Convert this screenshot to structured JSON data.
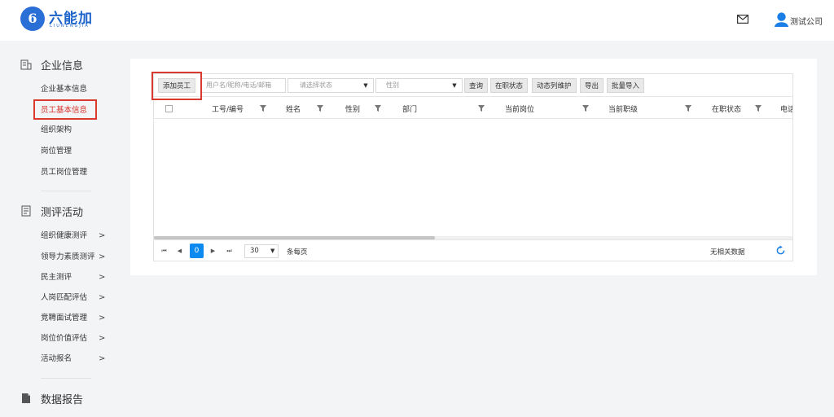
{
  "header": {
    "brand_cn": "六能加",
    "brand_en": "LIUNENGJIA",
    "logo_mark": "6",
    "company": "测试公司"
  },
  "sidebar": {
    "sections": [
      {
        "title": "企业信息",
        "icon": "building-icon",
        "items": [
          {
            "label": "企业基本信息",
            "arrow": ""
          },
          {
            "label": "员工基本信息",
            "arrow": "",
            "active": true
          },
          {
            "label": "组织架构",
            "arrow": ""
          },
          {
            "label": "岗位管理",
            "arrow": ""
          },
          {
            "label": "员工岗位管理",
            "arrow": ""
          }
        ]
      },
      {
        "title": "测评活动",
        "icon": "clipboard-icon",
        "items": [
          {
            "label": "组织健康测评",
            "arrow": ">"
          },
          {
            "label": "领导力素质测评",
            "arrow": ">"
          },
          {
            "label": "民主测评",
            "arrow": ">"
          },
          {
            "label": "人岗匹配评估",
            "arrow": ">"
          },
          {
            "label": "竞聘面试管理",
            "arrow": ">"
          },
          {
            "label": "岗位价值评估",
            "arrow": ">"
          },
          {
            "label": "活动报名",
            "arrow": ">"
          }
        ]
      },
      {
        "title": "数据报告",
        "icon": "report-icon",
        "items": []
      }
    ]
  },
  "toolbar": {
    "add_employee": "添加员工",
    "search_placeholder": "用户名/昵称/电话/邮箱",
    "status_select": "请选择状态",
    "gender_select": "性别",
    "query": "查询",
    "on_job_status": "在职状态",
    "dynamic_columns": "动态列维护",
    "export": "导出",
    "batch_import": "批量导入"
  },
  "table": {
    "columns": [
      "工号/编号",
      "姓名",
      "性别",
      "部门",
      "当前岗位",
      "当前职级",
      "在职状态",
      "电话"
    ],
    "rows": []
  },
  "pager": {
    "first": "⏮",
    "prev": "◀",
    "current_page": "0",
    "next": "▶",
    "last": "⏭",
    "page_size": "30",
    "per_page_label": "条每页",
    "no_data": "无相关数据"
  },
  "colors": {
    "accent_blue": "#0d8af0",
    "brand_blue": "#1b62c9",
    "active_red": "#d9342b"
  }
}
